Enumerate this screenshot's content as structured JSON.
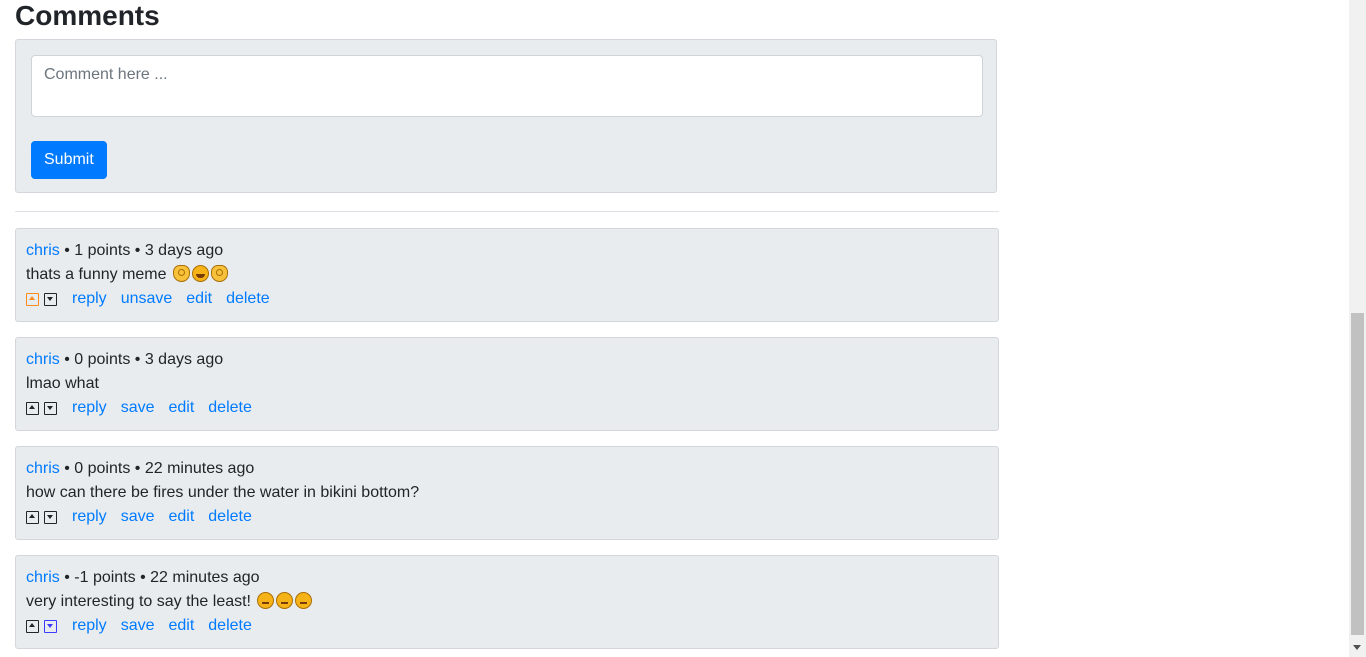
{
  "heading": "Comments",
  "form": {
    "placeholder": "Comment here ...",
    "submit_label": "Submit"
  },
  "comments": [
    {
      "author": "chris",
      "points": "1 points",
      "age": "3 days ago",
      "text": "thats a funny meme",
      "emojis": [
        "ok-hand-emoji",
        "laughing-face-emoji",
        "ok-hand-emoji"
      ],
      "upvoted": true,
      "downvoted": false,
      "actions": [
        "reply",
        "unsave",
        "edit",
        "delete"
      ]
    },
    {
      "author": "chris",
      "points": "0 points",
      "age": "3 days ago",
      "text": "lmao what",
      "emojis": [],
      "upvoted": false,
      "downvoted": false,
      "actions": [
        "reply",
        "save",
        "edit",
        "delete"
      ]
    },
    {
      "author": "chris",
      "points": "0 points",
      "age": "22 minutes ago",
      "text": "how can there be fires under the water in bikini bottom?",
      "emojis": [],
      "upvoted": false,
      "downvoted": false,
      "actions": [
        "reply",
        "save",
        "edit",
        "delete"
      ]
    },
    {
      "author": "chris",
      "points": "-1 points",
      "age": "22 minutes ago",
      "text": "very interesting to say the least!",
      "emojis": [
        "thinking-face-emoji",
        "thinking-face-emoji",
        "thinking-face-emoji"
      ],
      "upvoted": false,
      "downvoted": true,
      "actions": [
        "reply",
        "save",
        "edit",
        "delete"
      ]
    }
  ],
  "colors": {
    "link": "#007bff",
    "upvote_active": "#ff8b19",
    "downvote_active": "#3b3bff",
    "panel_bg": "#e9ecef"
  }
}
